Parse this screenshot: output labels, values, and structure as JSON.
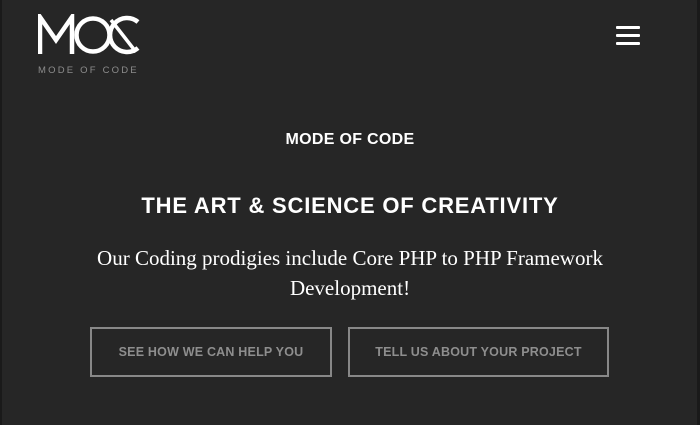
{
  "header": {
    "logo_mark": "MOC",
    "logo_text": "MODE OF CODE",
    "menu_icon": "hamburger-menu-icon"
  },
  "hero": {
    "eyebrow": "MODE OF CODE",
    "headline": "THE ART & SCIENCE OF CREATIVITY",
    "subline": "Our Coding prodigies include Core PHP to PHP Framework Development!"
  },
  "cta": {
    "primary_label": "SEE HOW WE CAN HELP YOU",
    "secondary_label": "TELL US ABOUT YOUR PROJECT"
  },
  "colors": {
    "background": "#262626",
    "text": "#ffffff",
    "button_border": "#888888",
    "button_text": "#8e8e8e",
    "logo_subtext": "#8c8c8c"
  }
}
